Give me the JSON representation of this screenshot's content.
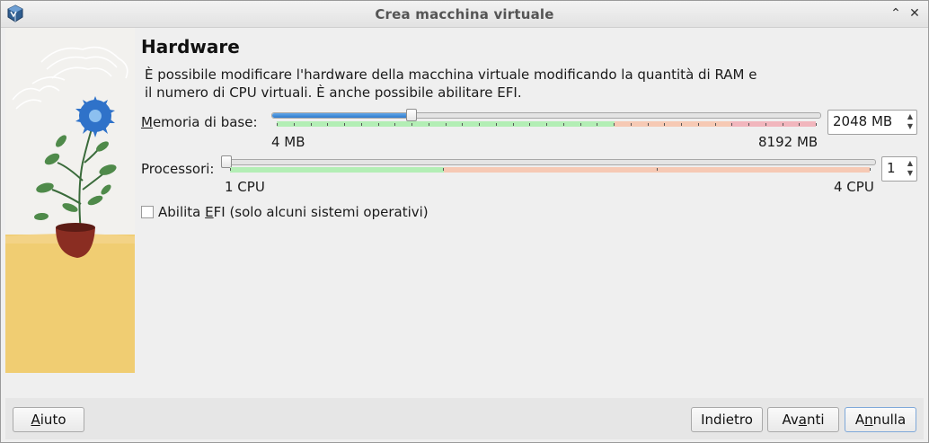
{
  "window": {
    "title": "Crea macchina virtuale",
    "icons": {
      "app": "virtualbox-icon",
      "shade": "chevron-up-icon",
      "close": "close-icon"
    }
  },
  "page": {
    "heading": "Hardware",
    "description_line1": "È possibile modificare l'hardware della macchina virtuale modificando la quantità di RAM e",
    "description_line2": "il numero di CPU virtuali. È anche possibile abilitare EFI."
  },
  "memory": {
    "label_mnemonic": "M",
    "label_rest": "emoria di base:",
    "value": 2048,
    "value_text": "2048 MB",
    "min": 4,
    "max": 8192,
    "min_label": "4 MB",
    "max_label": "8192 MB"
  },
  "processors": {
    "label": "Processori:",
    "value": 1,
    "value_text": "1",
    "min": 1,
    "max": 4,
    "min_label": "1 CPU",
    "max_label": "4 CPU"
  },
  "efi": {
    "checked": false,
    "label_pre": "Abilita ",
    "label_mnemonic": "E",
    "label_post": "FI (solo alcuni sistemi operativi)"
  },
  "buttons": {
    "help_mnemonic": "A",
    "help_rest": "iuto",
    "back": "Indietro",
    "next_pre": "Av",
    "next_mnemonic": "a",
    "next_post": "nti",
    "cancel_pre": "A",
    "cancel_mnemonic": "n",
    "cancel_post": "nulla"
  },
  "colors": {
    "zone_green": "#b3eeb5",
    "zone_orange": "#f6c9b4",
    "zone_red": "#f1b6bd",
    "slider_fill": "#3a86d6"
  }
}
